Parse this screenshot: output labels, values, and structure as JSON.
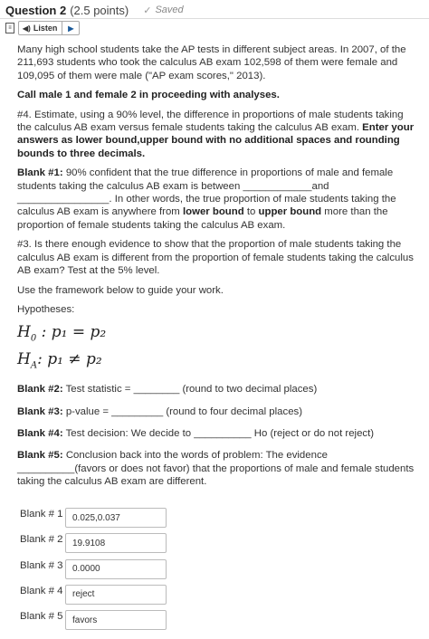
{
  "header": {
    "title": "Question 2",
    "points": "(2.5 points)",
    "saved": "Saved"
  },
  "listen": {
    "label": "Listen"
  },
  "intro": "Many high school students take the AP tests in different subject areas.  In 2007, of the 211,693 students who took the calculus AB exam 102,598 of them were female and 109,095 of them were male (\"AP exam scores,\" 2013).",
  "call_note": "Call male 1 and female 2 in proceeding with analyses.",
  "q4": {
    "text": "#4.  Estimate, using a 90% level, the difference in proportions of male students taking the calculus AB exam versus female students taking the calculus AB exam. ",
    "bold": "Enter your answers as lower bound,upper bound with no additional spaces and rounding bounds to three decimals."
  },
  "blank1": {
    "label": "Blank #1:",
    "part1": " 90% confident that the true difference in proportions of male and female students taking the calculus AB exam is between ____________and ________________.  In other words, the true proportion of male students taking the calculus AB exam is anywhere from ",
    "lower": "lower bound",
    "to": " to ",
    "upper": "upper bound",
    "part2": " more than the proportion of female students taking the calculus AB exam."
  },
  "q3": "#3. Is there enough evidence to show that the proportion of male students taking the calculus AB exam is different from the proportion of female students taking the calculus AB exam?  Test at the 5% level.",
  "framework": "Use the framework below to guide your work.",
  "hypotheses_label": "Hypotheses:",
  "h0": {
    "sym": "H",
    "sub": "0",
    "rest": " :   p₁ = p₂"
  },
  "ha": {
    "sym": "H",
    "sub": "A",
    "rest": ":  p₁ ≠ p₂"
  },
  "blank2": {
    "label": "Blank #2:",
    "text": "  Test statistic = ________ (round to two decimal places)"
  },
  "blank3": {
    "label": "Blank #3:",
    "text": "  p-value = _________ (round to four decimal places)"
  },
  "blank4": {
    "label": "Blank #4:",
    "text": "  Test decision:  We decide to __________ Ho (reject or do not reject)"
  },
  "blank5": {
    "label": "Blank #5:",
    "text": "  Conclusion back into the words of problem:  The evidence __________(favors or does not favor) that the proportions of male and female students taking the calculus AB exam are different."
  },
  "answers": [
    {
      "label": "Blank # 1",
      "value": "0.025,0.037"
    },
    {
      "label": "Blank # 2",
      "value": "19.9108"
    },
    {
      "label": "Blank # 3",
      "value": "0.0000"
    },
    {
      "label": "Blank # 4",
      "value": "reject"
    },
    {
      "label": "Blank # 5",
      "value": "favors"
    }
  ]
}
